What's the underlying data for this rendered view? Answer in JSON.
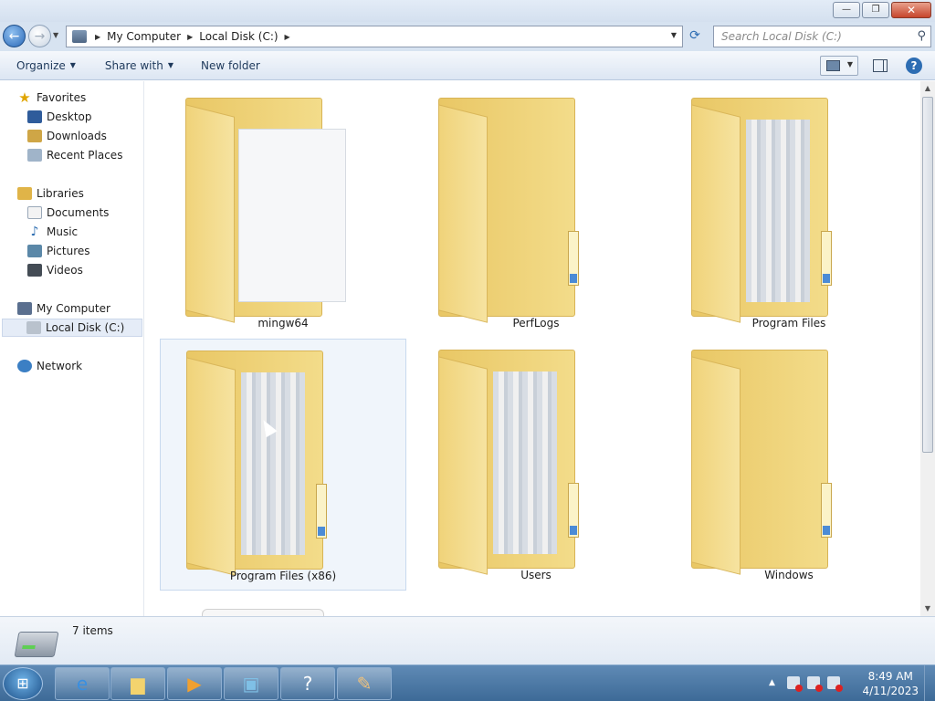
{
  "window": {
    "minimize_glyph": "—",
    "restore_glyph": "❐",
    "close_glyph": "✕"
  },
  "address_bar": {
    "breadcrumbs": [
      "My Computer",
      "Local Disk (C:)"
    ],
    "search_placeholder": "Search Local Disk (C:)"
  },
  "toolbar": {
    "organize_label": "Organize",
    "share_label": "Share with",
    "new_folder_label": "New folder"
  },
  "sidebar": {
    "favorites": {
      "label": "Favorites",
      "items": [
        "Desktop",
        "Downloads",
        "Recent Places"
      ]
    },
    "libraries": {
      "label": "Libraries",
      "items": [
        "Documents",
        "Music",
        "Pictures",
        "Videos"
      ]
    },
    "computer": {
      "label": "My Computer",
      "items": [
        "Local Disk (C:)"
      ]
    },
    "network": {
      "label": "Network"
    }
  },
  "folders": [
    {
      "name": "mingw64",
      "style": "document"
    },
    {
      "name": "PerfLogs",
      "style": "empty"
    },
    {
      "name": "Program Files",
      "style": "full"
    },
    {
      "name": "Program Files (x86)",
      "style": "full",
      "hovered": true
    },
    {
      "name": "Users",
      "style": "full"
    },
    {
      "name": "Windows",
      "style": "empty"
    }
  ],
  "status": {
    "item_count": "7 items"
  },
  "taskbar": {
    "clock_time": "8:49 AM",
    "clock_date": "4/11/2023",
    "apps": [
      "internet-explorer",
      "file-explorer",
      "media-player",
      "image-viewer",
      "help",
      "paint"
    ]
  },
  "colors": {
    "accent": "#2d6db3",
    "folder": "#f0d37a",
    "hover": "#f0f5fb"
  }
}
